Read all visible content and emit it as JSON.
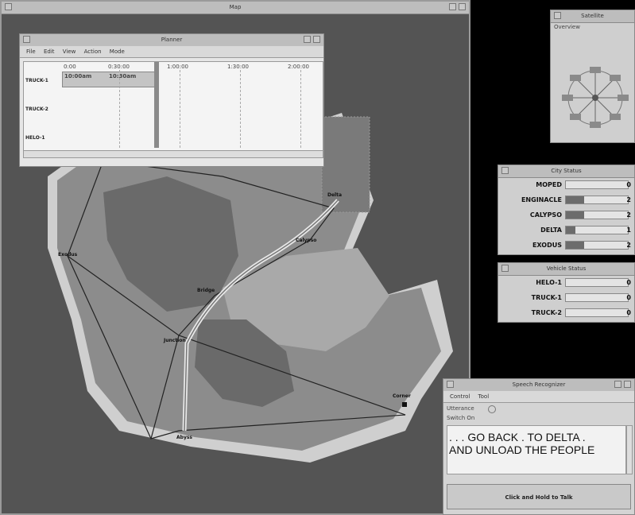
{
  "map_window": {
    "title": "Map"
  },
  "map_labels": {
    "north": "Delta",
    "mid_upper": "Calypso",
    "center": "Bridge",
    "west": "Exodus",
    "center_low": "Junction",
    "south": "Abyss",
    "east": "Corner"
  },
  "planner": {
    "title": "Planner",
    "menu": [
      "File",
      "Edit",
      "View",
      "Action",
      "Mode"
    ],
    "time_ticks": [
      "0:00",
      "0:30:00",
      "1:00:00",
      "1:30:00",
      "2:00:00"
    ],
    "block_labels": [
      "10:00am",
      "10:30am"
    ],
    "rows": [
      "TRUCK-1",
      "TRUCK-2",
      "HELO-1"
    ]
  },
  "satellite": {
    "title": "Satellite",
    "subtitle": "Overview"
  },
  "city_status": {
    "title": "City Status",
    "rows": [
      {
        "name": "MOPED",
        "value": "0",
        "fill": 0.0
      },
      {
        "name": "ENGINACLE",
        "value": "2",
        "fill": 0.3
      },
      {
        "name": "CALYPSO",
        "value": "2",
        "fill": 0.3
      },
      {
        "name": "DELTA",
        "value": "1",
        "fill": 0.15
      },
      {
        "name": "EXODUS",
        "value": "2",
        "fill": 0.3
      }
    ]
  },
  "vehicle_status": {
    "title": "Vehicle Status",
    "rows": [
      {
        "name": "HELO-1",
        "value": "0",
        "fill": 0.0
      },
      {
        "name": "TRUCK-1",
        "value": "0",
        "fill": 0.0
      },
      {
        "name": "TRUCK-2",
        "value": "0",
        "fill": 0.0
      }
    ]
  },
  "speech": {
    "title": "Speech Recognizer",
    "menu": [
      "Control",
      "Tool"
    ],
    "mode_label": "Utterance",
    "switch_label": "Switch On",
    "recognized_line1": ". . . GO BACK . TO DELTA .",
    "recognized_line2": "AND UNLOAD THE PEOPLE",
    "ptt_label": "Click and Hold to Talk"
  },
  "colors": {
    "water": "#545454",
    "land_light": "#a9a9a9",
    "land_mid": "#8c8c8c",
    "land_dark": "#6a6a6a",
    "beach": "#cfcfcf"
  }
}
